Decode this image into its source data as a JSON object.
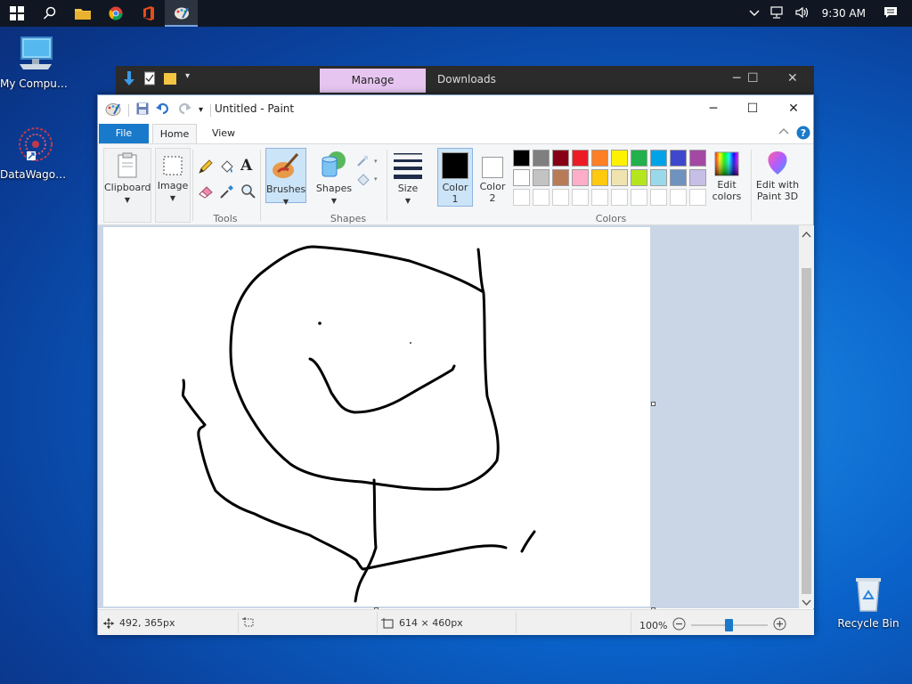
{
  "taskbar": {
    "time": "9:30 AM"
  },
  "desktop": {
    "icons": [
      {
        "label": "My Computer"
      },
      {
        "label": "DataWagon..."
      },
      {
        "label": "Recycle Bin"
      }
    ]
  },
  "explorer": {
    "manage_tab": "Manage",
    "title": "Downloads"
  },
  "paint": {
    "title": "Untitled - Paint",
    "tabs": {
      "file": "File",
      "home": "Home",
      "view": "View"
    },
    "ribbon": {
      "clipboard": "Clipboard",
      "image": "Image",
      "tools_group": "Tools",
      "brushes": "Brushes",
      "shapes": "Shapes",
      "shapes_group": "Shapes",
      "size": "Size",
      "color1_line1": "Color",
      "color1_line2": "1",
      "color2_line1": "Color",
      "color2_line2": "2",
      "colors_group": "Colors",
      "edit_colors_line1": "Edit",
      "edit_colors_line2": "colors",
      "paint3d_line1": "Edit with",
      "paint3d_line2": "Paint 3D"
    },
    "palette_row1": [
      "#000000",
      "#7f7f7f",
      "#880015",
      "#ed1c24",
      "#ff7f27",
      "#fff200",
      "#22b14c",
      "#00a2e8",
      "#3f48cc",
      "#a349a4"
    ],
    "palette_row2": [
      "#ffffff",
      "#c3c3c3",
      "#b97a57",
      "#ffaec9",
      "#ffc90e",
      "#efe4b0",
      "#b5e61d",
      "#99d9ea",
      "#7092be",
      "#c8bfe7"
    ],
    "status": {
      "cursor": "492, 365px",
      "canvas_size": "614 × 460px",
      "zoom": "100%"
    }
  }
}
